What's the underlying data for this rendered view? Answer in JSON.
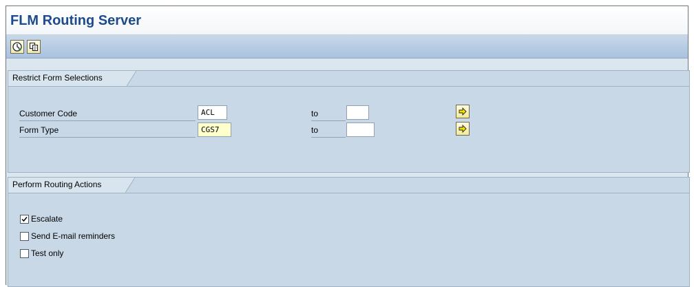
{
  "app": {
    "title": "FLM Routing Server"
  },
  "toolbar": {
    "buttons": [
      {
        "icon": "execute-clock-icon"
      },
      {
        "icon": "copy-variant-icon"
      }
    ]
  },
  "restrict": {
    "title": "Restrict Form Selections",
    "rows": [
      {
        "label": "Customer Code",
        "from": "ACL",
        "to_label": "to",
        "to": ""
      },
      {
        "label": "Form Type",
        "from": "CGS7",
        "to_label": "to",
        "to": ""
      }
    ]
  },
  "actions": {
    "title": "Perform Routing Actions",
    "checkboxes": [
      {
        "label": "Escalate",
        "checked": true
      },
      {
        "label": "Send E-mail reminders",
        "checked": false
      },
      {
        "label": "Test only",
        "checked": false
      }
    ]
  },
  "colors": {
    "title": "#1c4a8c",
    "panel": "#c8d8e6",
    "required": "#ffffcc"
  }
}
